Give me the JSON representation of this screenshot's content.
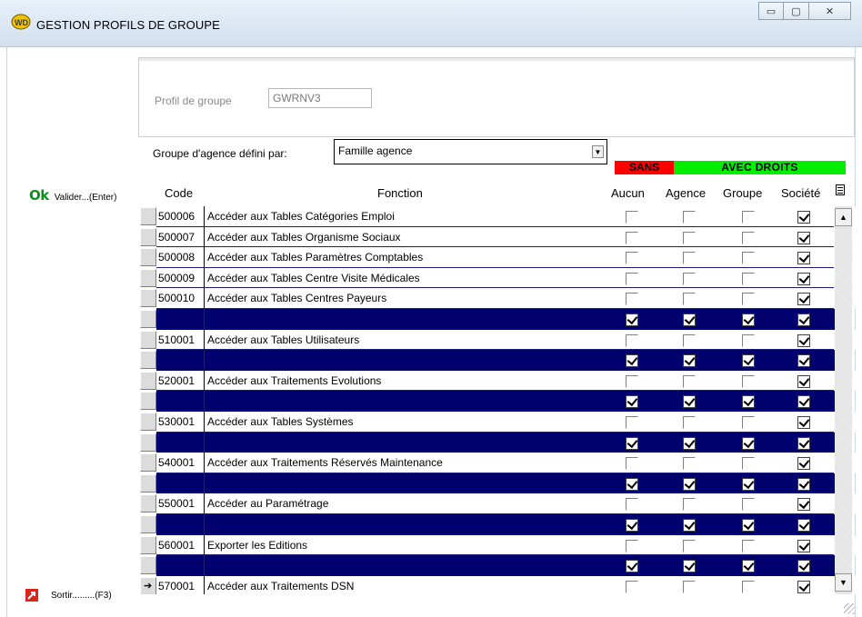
{
  "window": {
    "title": "GESTION PROFILS DE GROUPE",
    "minimize_glyph": "▭",
    "maximize_glyph": "▢",
    "close_glyph": "✕"
  },
  "actions": {
    "ok_glyph": "Ok",
    "ok_label": "Valider...(Enter)",
    "exit_label": "Sortir.........(F3)"
  },
  "profil": {
    "label": "Profil de groupe",
    "value": "GWRNV3"
  },
  "groupe_agence": {
    "label": "Groupe d'agence défini par:",
    "value": "Famille agence"
  },
  "badges": {
    "sans": "SANS",
    "avec": "AVEC DROITS",
    "sans_color": "#ff0000",
    "avec_color": "#00ee00"
  },
  "columns": {
    "code": "Code",
    "fonction": "Fonction",
    "aucun": "Aucun",
    "agence": "Agence",
    "groupe": "Groupe",
    "societe": "Société"
  },
  "rows": [
    {
      "code": "500006",
      "fonction": "Accéder aux Tables Catégories Emploi",
      "blank": false,
      "aucun": false,
      "agence": false,
      "groupe": false,
      "societe": true
    },
    {
      "code": "500007",
      "fonction": "Accéder aux Tables Organisme Sociaux",
      "blank": false,
      "aucun": false,
      "agence": false,
      "groupe": false,
      "societe": true
    },
    {
      "code": "500008",
      "fonction": "Accéder aux Tables Paramètres Comptables",
      "blank": false,
      "aucun": false,
      "agence": false,
      "groupe": false,
      "societe": true
    },
    {
      "code": "500009",
      "fonction": "Accéder aux Tables Centre Visite Médicales",
      "blank": false,
      "aucun": false,
      "agence": false,
      "groupe": false,
      "societe": true
    },
    {
      "code": "500010",
      "fonction": "Accéder aux Tables Centres Payeurs",
      "blank": false,
      "aucun": false,
      "agence": false,
      "groupe": false,
      "societe": true
    },
    {
      "code": "",
      "fonction": "",
      "blank": true,
      "aucun": true,
      "agence": true,
      "groupe": true,
      "societe": true
    },
    {
      "code": "510001",
      "fonction": "Accéder aux Tables Utilisateurs",
      "blank": false,
      "aucun": false,
      "agence": false,
      "groupe": false,
      "societe": true
    },
    {
      "code": "",
      "fonction": "",
      "blank": true,
      "aucun": true,
      "agence": true,
      "groupe": true,
      "societe": true
    },
    {
      "code": "520001",
      "fonction": "Accéder aux Traitements Evolutions",
      "blank": false,
      "aucun": false,
      "agence": false,
      "groupe": false,
      "societe": true
    },
    {
      "code": "",
      "fonction": "",
      "blank": true,
      "aucun": true,
      "agence": true,
      "groupe": true,
      "societe": true
    },
    {
      "code": "530001",
      "fonction": "Accéder aux Tables Systèmes",
      "blank": false,
      "aucun": false,
      "agence": false,
      "groupe": false,
      "societe": true
    },
    {
      "code": "",
      "fonction": "",
      "blank": true,
      "aucun": true,
      "agence": true,
      "groupe": true,
      "societe": true
    },
    {
      "code": "540001",
      "fonction": "Accéder aux Traitements Réservés Maintenance",
      "blank": false,
      "aucun": false,
      "agence": false,
      "groupe": false,
      "societe": true
    },
    {
      "code": "",
      "fonction": "",
      "blank": true,
      "aucun": true,
      "agence": true,
      "groupe": true,
      "societe": true
    },
    {
      "code": "550001",
      "fonction": "Accéder au Paramétrage",
      "blank": false,
      "aucun": false,
      "agence": false,
      "groupe": false,
      "societe": true
    },
    {
      "code": "",
      "fonction": "",
      "blank": true,
      "aucun": true,
      "agence": true,
      "groupe": true,
      "societe": true
    },
    {
      "code": "560001",
      "fonction": "Exporter les Editions",
      "blank": false,
      "aucun": false,
      "agence": false,
      "groupe": false,
      "societe": true
    },
    {
      "code": "",
      "fonction": "",
      "blank": true,
      "aucun": true,
      "agence": true,
      "groupe": true,
      "societe": true
    },
    {
      "code": "570001",
      "fonction": "Accéder aux Traitements DSN",
      "blank": false,
      "aucun": false,
      "agence": false,
      "groupe": false,
      "societe": true,
      "current": true
    }
  ],
  "scrollbar": {
    "up_glyph": "▲",
    "down_glyph": "▼"
  },
  "current_row_pointer": "➔"
}
